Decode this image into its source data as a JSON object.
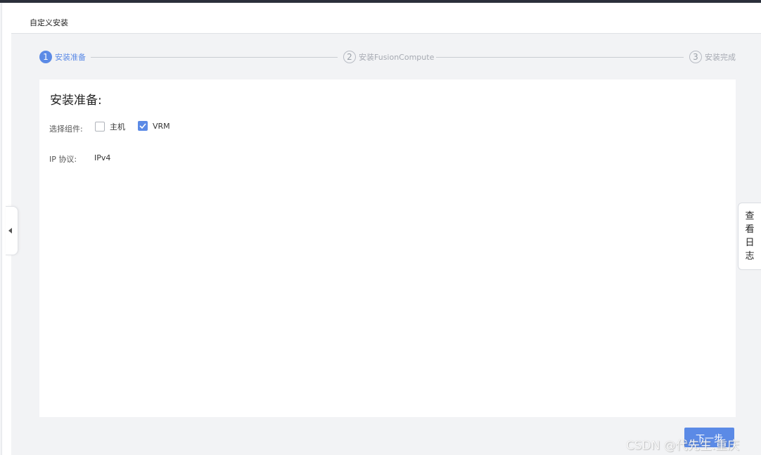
{
  "header": {
    "title": "自定义安装"
  },
  "steps": [
    {
      "num": "1",
      "label": "安装准备",
      "state": "active"
    },
    {
      "num": "2",
      "label": "安装FusionCompute",
      "state": "pending"
    },
    {
      "num": "3",
      "label": "安装完成",
      "state": "pending"
    }
  ],
  "card": {
    "heading": "安装准备:",
    "components_label": "选择组件:",
    "components": [
      {
        "label": "主机",
        "checked": false
      },
      {
        "label": "VRM",
        "checked": true
      }
    ],
    "ip_label": "IP 协议:",
    "ip_value": "IPv4"
  },
  "side_log": {
    "label": [
      "查",
      "看",
      "日",
      "志"
    ]
  },
  "footer": {
    "next_label": "下一步"
  },
  "watermark": "CSDN @代先生.重庆",
  "colors": {
    "accent": "#5b8ae6",
    "background": "#f2f3f5",
    "topbar": "#2b2f3a"
  }
}
